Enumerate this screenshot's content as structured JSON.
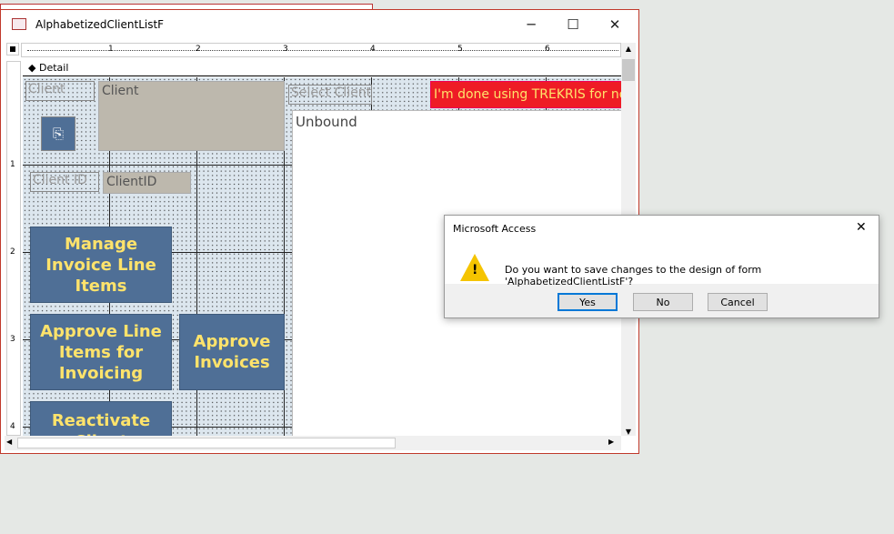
{
  "window": {
    "title": "AlphabetizedClientListF",
    "minimize": "─",
    "maximize": "☐",
    "close": "✕"
  },
  "ruler": {
    "h_labels": [
      "1",
      "2",
      "3",
      "4",
      "5",
      "6"
    ],
    "v_labels": [
      "1",
      "2",
      "3",
      "4"
    ]
  },
  "section": {
    "label": "Detail"
  },
  "form": {
    "client_label": "Client",
    "client_field": "Client",
    "client_id_label": "Client ID",
    "client_id_field": "ClientID",
    "select_client_label": "Select Client",
    "listbox_value": "Unbound",
    "done_button": "I'm done using TREKRIS for now",
    "buttons": {
      "manage": "Manage Invoice Line Items",
      "approve_line": "Approve Line Items for Invoicing",
      "approve_invoices": "Approve Invoices",
      "reactivate": "Reactivate Client"
    }
  },
  "dialog": {
    "title": "Microsoft Access",
    "message": "Do you want to save changes to the design of form 'AlphabetizedClientListF'?",
    "yes": "Yes",
    "no": "No",
    "cancel": "Cancel",
    "close": "✕"
  },
  "colors": {
    "button_bg": "#4f6f96",
    "button_text": "#ffe36b",
    "done_bg": "#ee1c25"
  }
}
